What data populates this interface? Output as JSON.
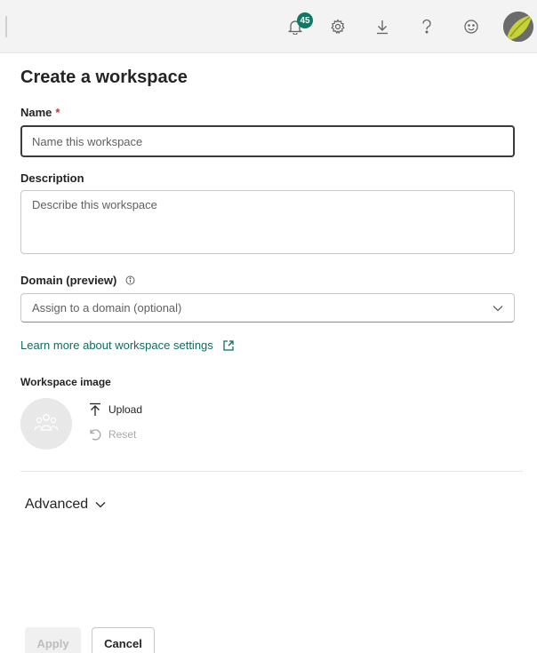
{
  "topbar": {
    "notification_count": "45",
    "icons": [
      "bell-icon",
      "gear-icon",
      "download-icon",
      "help-icon",
      "smiley-icon"
    ]
  },
  "panel": {
    "title": "Create a workspace",
    "name_label": "Name",
    "name_required_mark": "*",
    "name_placeholder": "Name this workspace",
    "description_label": "Description",
    "description_placeholder": "Describe this workspace",
    "domain_label": "Domain (preview)",
    "domain_placeholder": "Assign to a domain (optional)",
    "learn_more_link": "Learn more about workspace settings",
    "workspace_image_label": "Workspace image",
    "upload_label": "Upload",
    "reset_label": "Reset",
    "advanced_label": "Advanced"
  },
  "footer": {
    "apply_label": "Apply",
    "cancel_label": "Cancel"
  },
  "colors": {
    "accent": "#117865",
    "link": "#0f6c5f",
    "required": "#c4314b"
  }
}
